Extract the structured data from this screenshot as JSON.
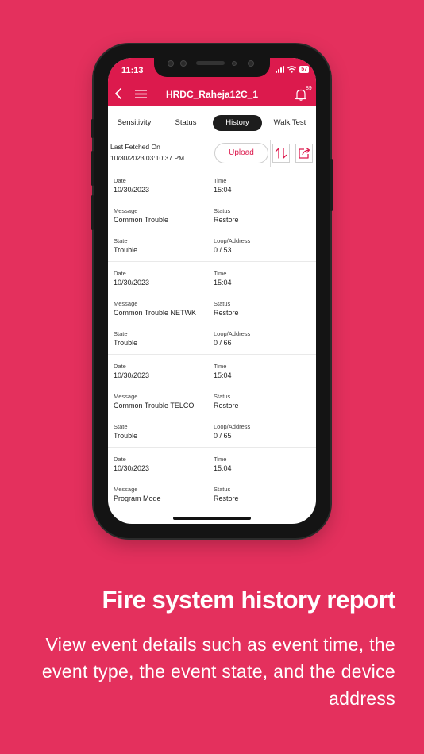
{
  "status_bar": {
    "time": "11:13",
    "battery": "57"
  },
  "header": {
    "title": "HRDC_Raheja12C_1",
    "notification_count": "89"
  },
  "tabs": [
    {
      "label": "Sensitivity",
      "active": false
    },
    {
      "label": "Status",
      "active": false
    },
    {
      "label": "History",
      "active": true
    },
    {
      "label": "Walk Test",
      "active": false
    }
  ],
  "fetch": {
    "label": "Last Fetched On",
    "value": "10/30/2023 03:10:37 PM"
  },
  "toolbar": {
    "upload_label": "Upload"
  },
  "field_labels": {
    "date": "Date",
    "time": "Time",
    "message": "Message",
    "status": "Status",
    "state": "State",
    "loop": "Loop/Address"
  },
  "records": [
    {
      "date": "10/30/2023",
      "time": "15:04",
      "message": "Common Trouble",
      "status": "Restore",
      "state": "Trouble",
      "loop": "0 / 53"
    },
    {
      "date": "10/30/2023",
      "time": "15:04",
      "message": "Common Trouble NETWK",
      "status": "Restore",
      "state": "Trouble",
      "loop": "0 / 66"
    },
    {
      "date": "10/30/2023",
      "time": "15:04",
      "message": "Common Trouble TELCO",
      "status": "Restore",
      "state": "Trouble",
      "loop": "0 / 65"
    },
    {
      "date": "10/30/2023",
      "time": "15:04",
      "message": "Program Mode",
      "status": "Restore"
    }
  ],
  "promo": {
    "headline": "Fire system history report",
    "body": "View event details such as event time, the event type, the event state, and the device address"
  },
  "colors": {
    "brand": "#dc1a4d",
    "background": "#e4305d",
    "tab_active": "#1d1d1d"
  },
  "icons": [
    "back-arrow-icon",
    "hamburger-menu-icon",
    "bell-icon",
    "sort-icon",
    "share-icon",
    "wifi-icon",
    "signal-icon"
  ]
}
